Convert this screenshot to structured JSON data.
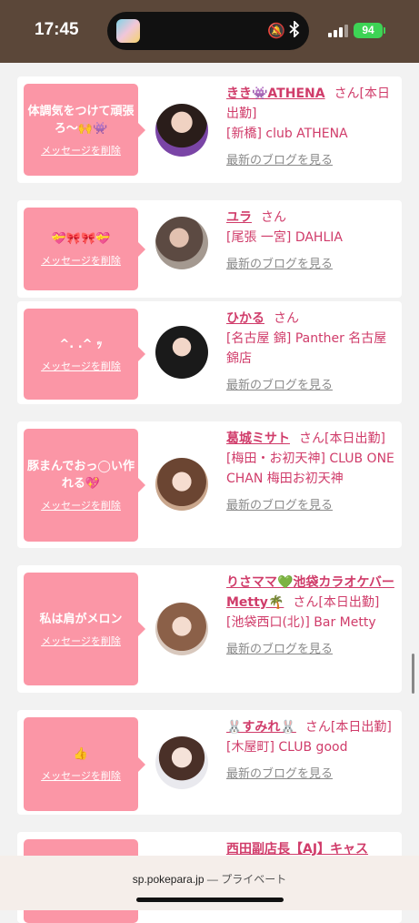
{
  "status_bar": {
    "time": "17:45",
    "battery": "94"
  },
  "cards": [
    {
      "message": "体調気をつけて頑張ろ〜🙌👾",
      "delete_label": "メッセージを削除",
      "name": "きき👾ATHENA",
      "suffix": "さん[本日出勤]",
      "shop": "[新橋] club ATHENA",
      "blog_label": "最新のブログを見る"
    },
    {
      "message": "💝🎀🎀💝",
      "delete_label": "メッセージを削除",
      "name": "ユラ",
      "suffix": "さん",
      "shop": "[尾張 一宮] DAHLIA",
      "blog_label": "最新のブログを見る"
    },
    {
      "message": "^. .^ ｯ",
      "delete_label": "メッセージを削除",
      "name": "ひかる",
      "suffix": "さん",
      "shop": "[名古屋 錦] Panther 名古屋 錦店",
      "blog_label": "最新のブログを見る"
    },
    {
      "message": "豚まんでおっ◯い作れる💖",
      "delete_label": "メッセージを削除",
      "name": "葛城ミサト",
      "suffix": "さん[本日出勤]",
      "shop": "[梅田・お初天神] CLUB ONE CHAN 梅田お初天神",
      "blog_label": "最新のブログを見る"
    },
    {
      "message": "私は肩がメロン",
      "delete_label": "メッセージを削除",
      "name": "りさママ💚池袋カラオケバーMetty🌴",
      "suffix": "さん[本日出勤]",
      "shop": "[池袋西口(北)] Bar Metty",
      "blog_label": "最新のブログを見る"
    },
    {
      "message": "👍",
      "delete_label": "メッセージを削除",
      "name": "🐰すみれ🐰",
      "suffix": "さん[本日出勤]",
      "shop": "[木屋町] CLUB good",
      "blog_label": "最新のブログを見る"
    },
    {
      "message": "",
      "delete_label": "",
      "name": "西田副店長【AJ】キャス",
      "suffix": "",
      "shop": "",
      "blog_label": ""
    }
  ],
  "browser_bar": {
    "url": "sp.pokepara.jp",
    "separator": "—",
    "mode": "プライベート"
  },
  "icons": {
    "mute": "bell-slash-icon",
    "bluetooth": "bluetooth-icon",
    "signal": "signal-bars-icon",
    "battery": "battery-icon"
  },
  "colors": {
    "accent_pink": "#d03c6a",
    "bubble_pink": "#fb96a6",
    "status_bar_bg": "#5b4739",
    "battery_green": "#3dd455"
  }
}
